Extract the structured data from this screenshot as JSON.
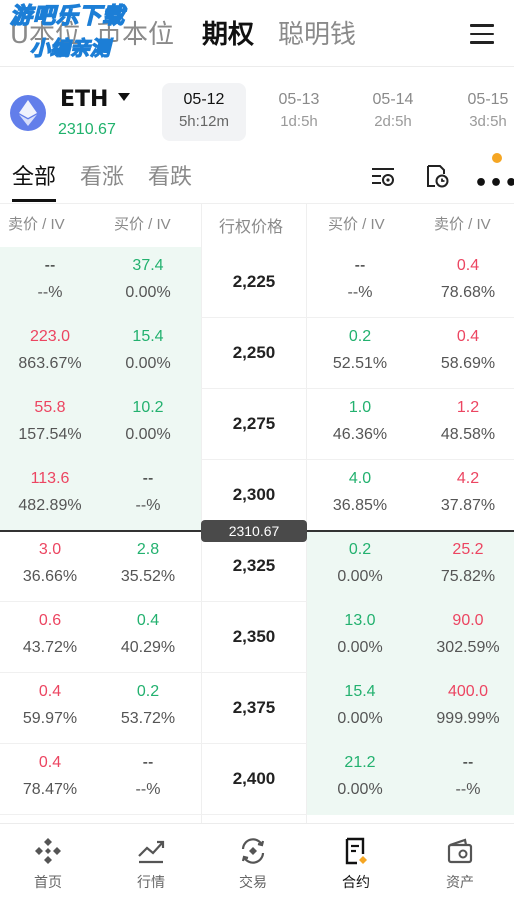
{
  "watermark": {
    "line1": "游吧乐下载",
    "line2": "小编亲测"
  },
  "topnav": {
    "tabs": [
      {
        "label": "U本位"
      },
      {
        "label": "币本位"
      },
      {
        "label": "期权"
      },
      {
        "label": "聪明钱"
      }
    ]
  },
  "asset": {
    "symbol": "ETH",
    "price": "2310.67"
  },
  "expiries": [
    {
      "date": "05-12",
      "remaining": "5h:12m"
    },
    {
      "date": "05-13",
      "remaining": "1d:5h"
    },
    {
      "date": "05-14",
      "remaining": "2d:5h"
    },
    {
      "date": "05-15",
      "remaining": "3d:5h"
    }
  ],
  "filters": {
    "all": "全部",
    "calls": "看涨",
    "puts": "看跌",
    "more": "•••"
  },
  "columns": {
    "call_ask": "卖价 / IV",
    "call_bid": "买价 / IV",
    "strike": "行权价格",
    "put_bid": "买价 / IV",
    "put_ask": "卖价 / IV"
  },
  "spot_badge": "2310.67",
  "rows": [
    {
      "strike": "2,225",
      "call_ask": "--",
      "call_ask_iv": "--%",
      "call_bid": "37.4",
      "call_bid_iv": "0.00%",
      "put_bid": "--",
      "put_bid_iv": "--%",
      "put_ask": "0.4",
      "put_ask_iv": "78.68%"
    },
    {
      "strike": "2,250",
      "call_ask": "223.0",
      "call_ask_iv": "863.67%",
      "call_bid": "15.4",
      "call_bid_iv": "0.00%",
      "put_bid": "0.2",
      "put_bid_iv": "52.51%",
      "put_ask": "0.4",
      "put_ask_iv": "58.69%"
    },
    {
      "strike": "2,275",
      "call_ask": "55.8",
      "call_ask_iv": "157.54%",
      "call_bid": "10.2",
      "call_bid_iv": "0.00%",
      "put_bid": "1.0",
      "put_bid_iv": "46.36%",
      "put_ask": "1.2",
      "put_ask_iv": "48.58%"
    },
    {
      "strike": "2,300",
      "call_ask": "113.6",
      "call_ask_iv": "482.89%",
      "call_bid": "--",
      "call_bid_iv": "--%",
      "put_bid": "4.0",
      "put_bid_iv": "36.85%",
      "put_ask": "4.2",
      "put_ask_iv": "37.87%"
    },
    {
      "strike": "2,325",
      "call_ask": "3.0",
      "call_ask_iv": "36.66%",
      "call_bid": "2.8",
      "call_bid_iv": "35.52%",
      "put_bid": "0.2",
      "put_bid_iv": "0.00%",
      "put_ask": "25.2",
      "put_ask_iv": "75.82%"
    },
    {
      "strike": "2,350",
      "call_ask": "0.6",
      "call_ask_iv": "43.72%",
      "call_bid": "0.4",
      "call_bid_iv": "40.29%",
      "put_bid": "13.0",
      "put_bid_iv": "0.00%",
      "put_ask": "90.0",
      "put_ask_iv": "302.59%"
    },
    {
      "strike": "2,375",
      "call_ask": "0.4",
      "call_ask_iv": "59.97%",
      "call_bid": "0.2",
      "call_bid_iv": "53.72%",
      "put_bid": "15.4",
      "put_bid_iv": "0.00%",
      "put_ask": "400.0",
      "put_ask_iv": "999.99%"
    },
    {
      "strike": "2,400",
      "call_ask": "0.4",
      "call_ask_iv": "78.47%",
      "call_bid": "--",
      "call_bid_iv": "--%",
      "put_bid": "21.2",
      "put_bid_iv": "0.00%",
      "put_ask": "--",
      "put_ask_iv": "--%"
    }
  ],
  "bottomnav": [
    {
      "label": "首页",
      "icon": "home-diamond-icon"
    },
    {
      "label": "行情",
      "icon": "market-chart-icon"
    },
    {
      "label": "交易",
      "icon": "trade-exchange-icon"
    },
    {
      "label": "合约",
      "icon": "contract-doc-icon"
    },
    {
      "label": "资产",
      "icon": "wallet-icon"
    }
  ],
  "colors": {
    "green": "#23b16f",
    "red": "#ec4561",
    "itm_bg": "#eef8f3",
    "accent": "#f5a623"
  }
}
